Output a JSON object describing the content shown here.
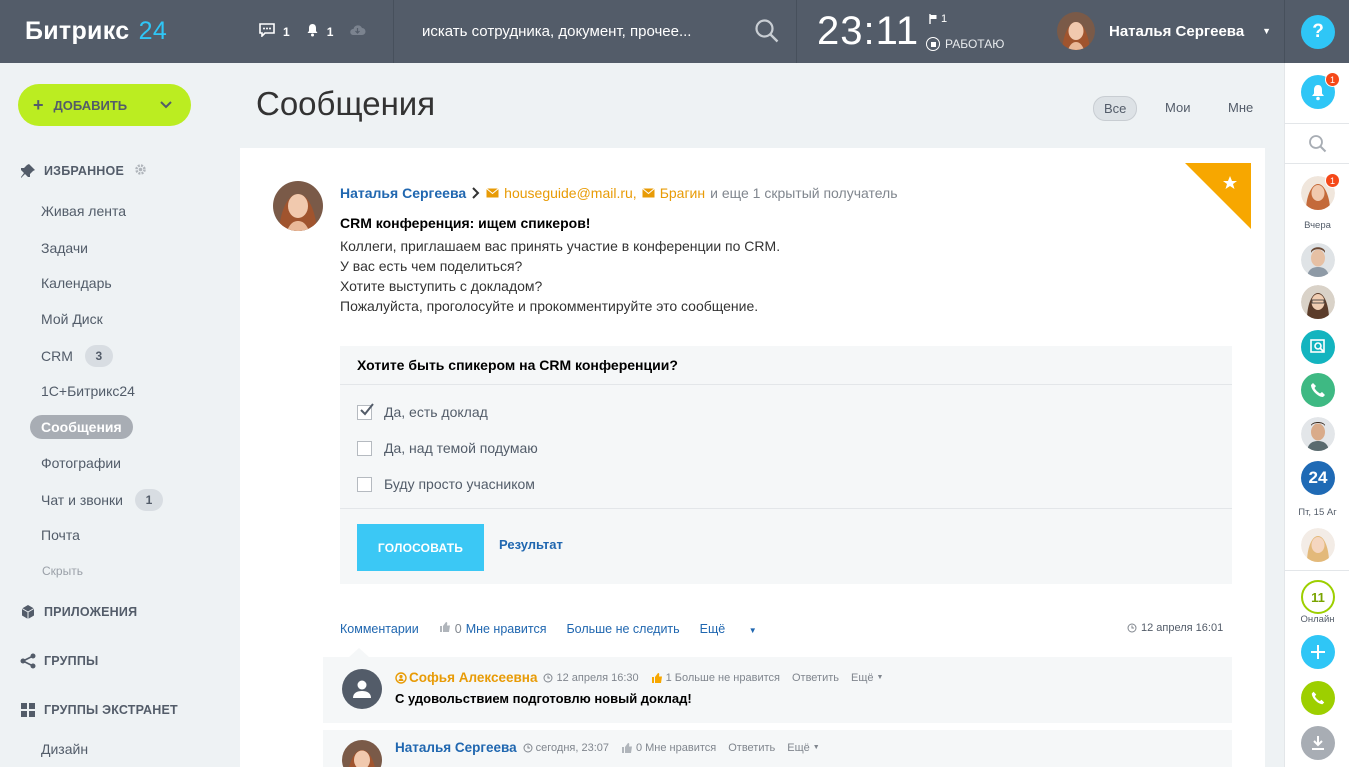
{
  "header": {
    "logo_text": "Битрикс",
    "logo_num": "24",
    "messages_count": "1",
    "notifications_count": "1",
    "search_placeholder": "искать сотрудника, документ, прочее...",
    "clock": "23:11",
    "flag_count": "1",
    "work_status": "РАБОТАЮ",
    "user_name": "Наталья Сергеева",
    "help": "?"
  },
  "sidebar": {
    "add_button": "ДОБАВИТЬ",
    "favorites": "ИЗБРАННОЕ",
    "items": [
      {
        "label": "Живая лента"
      },
      {
        "label": "Задачи"
      },
      {
        "label": "Календарь"
      },
      {
        "label": "Мой Диск"
      },
      {
        "label": "CRM",
        "badge": "3"
      },
      {
        "label": "1С+Битрикс24"
      },
      {
        "label": "Сообщения"
      },
      {
        "label": "Фотографии"
      },
      {
        "label": "Чат и звонки",
        "badge": "1"
      },
      {
        "label": "Почта"
      }
    ],
    "hide": "Скрыть",
    "apps": "ПРИЛОЖЕНИЯ",
    "groups": "ГРУППЫ",
    "extranet": "ГРУППЫ ЭКСТРАНЕТ",
    "design": "Дизайн"
  },
  "main": {
    "title": "Сообщения",
    "filters": [
      "Все",
      "Мои",
      "Мне"
    ]
  },
  "post": {
    "author": "Наталья Сергеева",
    "recipient1": "houseguide@mail.ru,",
    "recipient2": "Брагин",
    "recipients_rest": "и еще 1 скрытый получатель",
    "title": "CRM конференция: ищем спикеров!",
    "lines": [
      "Коллеги, приглашаем вас принять участие в конференции по CRM.",
      "У вас есть чем поделиться?",
      "Хотите выступить с докладом?",
      "Пожалуйста, проголосуйте и прокомментируйте это сообщение."
    ],
    "vote": {
      "question": "Хотите быть спикером на CRM конференции?",
      "options": [
        {
          "label": "Да, есть доклад",
          "checked": true
        },
        {
          "label": "Да, над темой подумаю",
          "checked": false
        },
        {
          "label": "Буду просто учасником",
          "checked": false
        }
      ],
      "button": "ГОЛОСОВАТЬ",
      "result": "Результат"
    },
    "actions": {
      "comments": "Комментарии",
      "likes": "0",
      "like": "Мне нравится",
      "unfollow": "Больше не следить",
      "more": "Ещё"
    },
    "date": "12 апреля 16:01"
  },
  "comments": [
    {
      "name": "Софья Алексеевна",
      "date": "12 апреля 16:30",
      "likes": "1",
      "like": "Больше не нравится",
      "reply": "Ответить",
      "more": "Ещё",
      "text": "С удовольствием подготовлю новый доклад!"
    },
    {
      "name": "Наталья Сергеева",
      "date": "сегодня, 23:07",
      "likes": "0",
      "like": "Мне нравится",
      "reply": "Ответить",
      "more": "Ещё"
    }
  ],
  "right_sidebar": {
    "notif_badge": "1",
    "user1_badge": "1",
    "label_yesterday": "Вчера",
    "tile_24": "24",
    "label_friday": "Пт, 15 Аг",
    "online_count": "11",
    "online_label": "Онлайн"
  },
  "colors": {
    "header_bg": "#535c69",
    "accent_blue": "#2fc6f6",
    "add_green": "#bbed21",
    "link_blue": "#2067b0",
    "mail_orange": "#e89b06",
    "fav_orange": "#f7a700"
  }
}
